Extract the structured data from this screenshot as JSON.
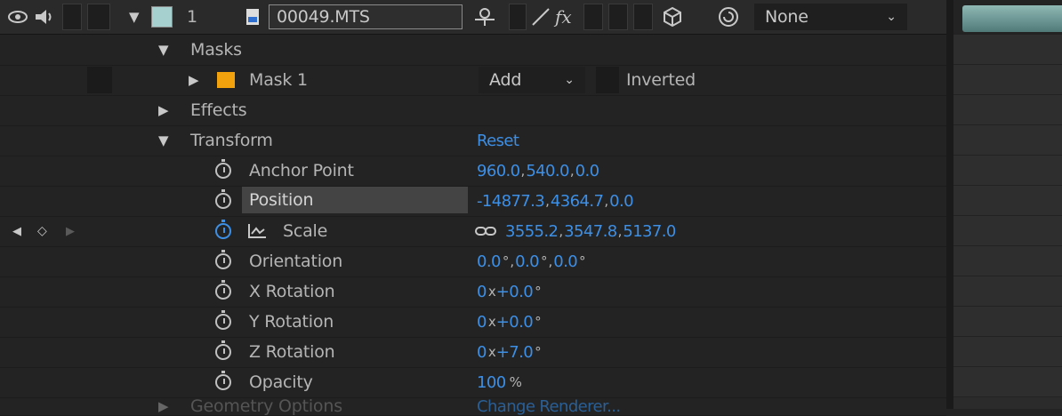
{
  "layer": {
    "number": "1",
    "name": "00049.MTS",
    "parent": "None",
    "label_color": "#a6cfcf"
  },
  "masks": {
    "group_label": "Masks",
    "mask1": {
      "label": "Mask 1",
      "color": "#f2a20c",
      "mode": "Add",
      "inverted_label": "Inverted"
    }
  },
  "effects_label": "Effects",
  "transform": {
    "label": "Transform",
    "reset_label": "Reset",
    "props": [
      {
        "name": "Anchor Point",
        "v1": "960.0",
        "v2": "540.0",
        "v3": "0.0"
      },
      {
        "name": "Position",
        "v1": "-14877.3",
        "v2": "4364.7",
        "v3": "0.0"
      },
      {
        "name": "Scale",
        "v1": "3555.2",
        "v2": "3547.8",
        "v3": "5137.0"
      },
      {
        "name": "Orientation",
        "v1": "0.0",
        "v2": "0.0",
        "v3": "0.0",
        "unit": "°"
      },
      {
        "name": "X Rotation",
        "rev": "0",
        "x": "x",
        "deg": "+0.0",
        "unit": "°"
      },
      {
        "name": "Y Rotation",
        "rev": "0",
        "x": "x",
        "deg": "+0.0",
        "unit": "°"
      },
      {
        "name": "Z Rotation",
        "rev": "0",
        "x": "x",
        "deg": "+7.0",
        "unit": "°"
      },
      {
        "name": "Opacity",
        "value": "100",
        "unit": "%"
      }
    ]
  },
  "geometry_options": {
    "label": "Geometry Options",
    "action": "Change Renderer..."
  },
  "icons": {
    "eye": "eye-icon",
    "audio": "speaker-icon",
    "switch": "shy-icon",
    "fx": "fx-icon",
    "cube": "3d-layer-icon",
    "spiral": "motion-blur-icon",
    "link": "constrain-proportions-icon"
  }
}
